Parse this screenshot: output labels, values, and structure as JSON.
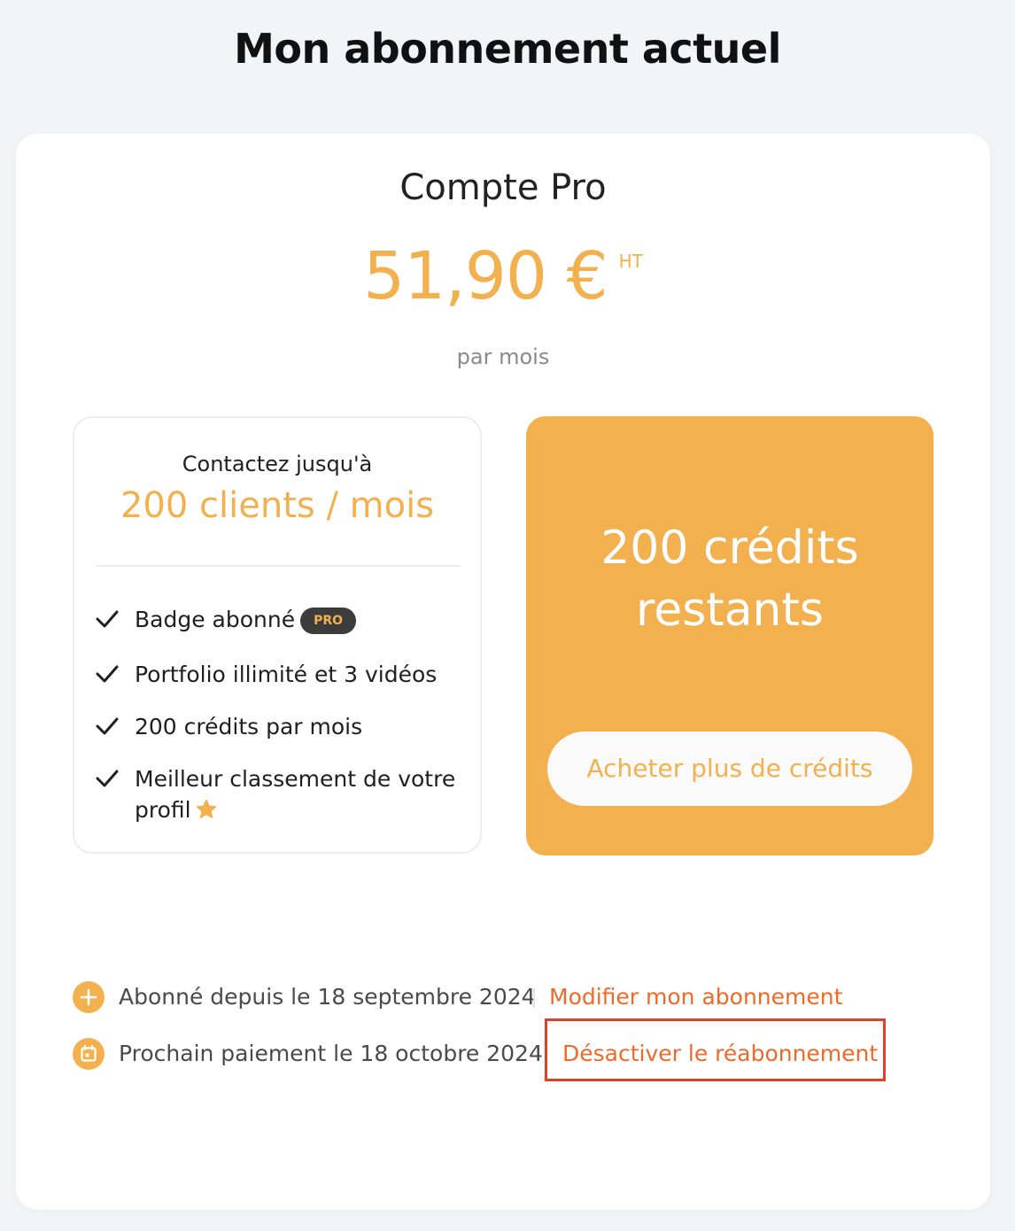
{
  "page": {
    "title": "Mon abonnement actuel"
  },
  "plan": {
    "name": "Compte Pro",
    "price": "51,90 €",
    "price_suffix": "HT",
    "period": "par mois"
  },
  "features_box": {
    "contact_label": "Contactez jusqu'à",
    "contact_value": "200 clients / mois",
    "features": [
      {
        "text": "Badge abonné",
        "badge": "PRO"
      },
      {
        "text": "Portfolio illimité et 3 vidéos"
      },
      {
        "text": "200 crédits par mois"
      },
      {
        "text": "Meilleur classement de votre profil",
        "icon": "star-icon"
      }
    ]
  },
  "credits_box": {
    "remaining_line1": "200 crédits",
    "remaining_line2": "restants",
    "buy_button_label": "Acheter plus de crédits"
  },
  "subscription_info": {
    "subscribed_since": "Abonné depuis le 18 septembre 2024",
    "modify_link": "Modifier mon abonnement",
    "next_payment": "Prochain paiement le 18 octobre 2024",
    "deactivate_link": "Désactiver le réabonnement"
  },
  "colors": {
    "accent": "#f2b04e",
    "link": "#ec6b2a",
    "highlight_border": "#e0402a",
    "background": "#f3f4f6",
    "badge_bg": "#3c3c3c"
  }
}
